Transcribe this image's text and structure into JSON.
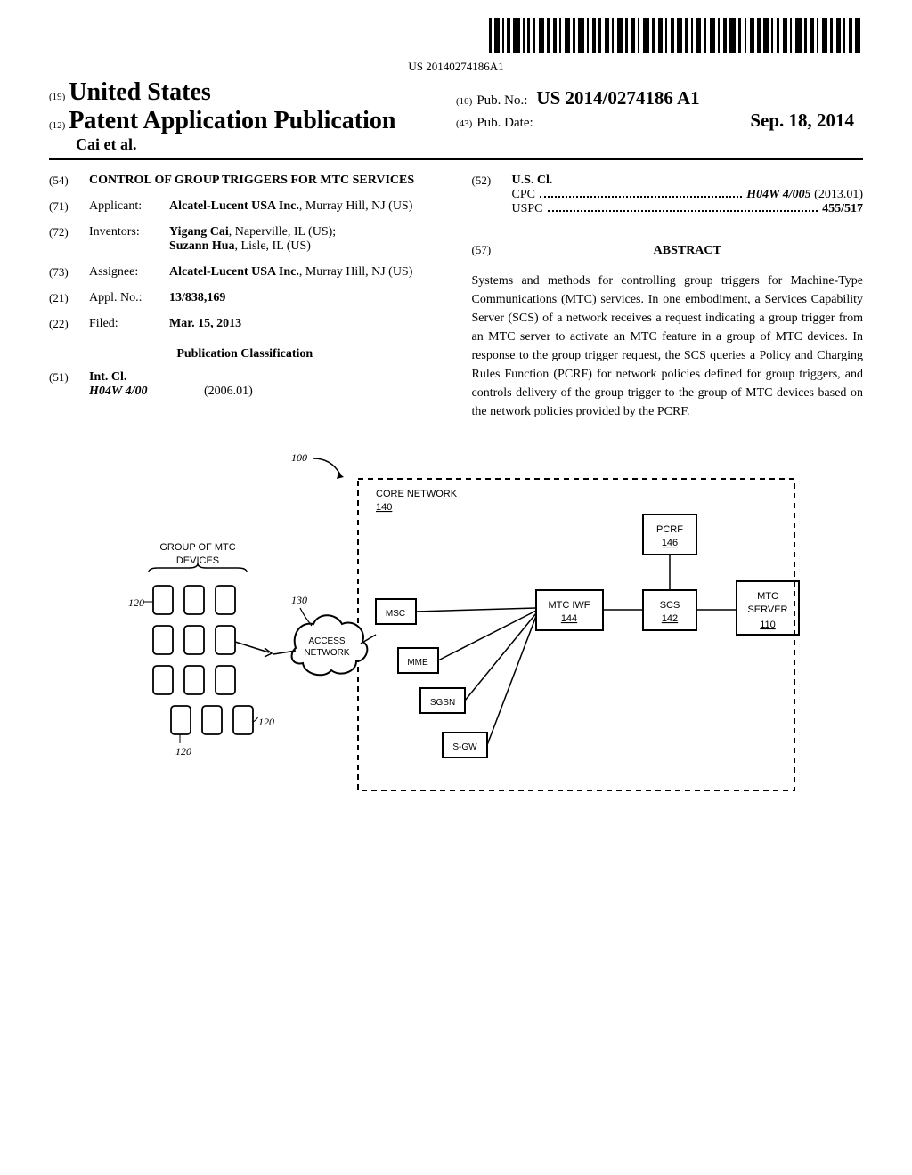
{
  "barcode_number": "US 20140274186A1",
  "header": {
    "inid_country": "(19)",
    "country": "United States",
    "inid_pubtype": "(12)",
    "pub_type": "Patent Application Publication",
    "authors": "Cai et al.",
    "inid_pubno": "(10)",
    "pubno_label": "Pub. No.:",
    "pubno_value": "US 2014/0274186 A1",
    "inid_pubdate": "(43)",
    "pubdate_label": "Pub. Date:",
    "pubdate_value": "Sep. 18, 2014"
  },
  "fields": {
    "title": {
      "code": "(54)",
      "value": "CONTROL OF GROUP TRIGGERS FOR MTC SERVICES"
    },
    "applicant": {
      "code": "(71)",
      "label": "Applicant:",
      "name": "Alcatel-Lucent USA Inc.",
      "location": ", Murray Hill, NJ (US)"
    },
    "inventors": {
      "code": "(72)",
      "label": "Inventors:",
      "name1": "Yigang Cai",
      "loc1": ", Naperville, IL (US);",
      "name2": "Suzann Hua",
      "loc2": ", Lisle, IL (US)"
    },
    "assignee": {
      "code": "(73)",
      "label": "Assignee:",
      "name": "Alcatel-Lucent USA Inc.",
      "location": ", Murray Hill, NJ (US)"
    },
    "applno": {
      "code": "(21)",
      "label": "Appl. No.:",
      "value": "13/838,169"
    },
    "filed": {
      "code": "(22)",
      "label": "Filed:",
      "value": "Mar. 15, 2013"
    },
    "pubclass_header": "Publication Classification",
    "intcl": {
      "code": "(51)",
      "label": "Int. Cl.",
      "class": "H04W 4/00",
      "date": "(2006.01)"
    },
    "uscl": {
      "code": "(52)",
      "label": "U.S. Cl.",
      "cpc_label": "CPC",
      "cpc_value": "H04W 4/005",
      "cpc_date": " (2013.01)",
      "uspc_label": "USPC",
      "uspc_value": "455/517"
    }
  },
  "abstract": {
    "code": "(57)",
    "header": "ABSTRACT",
    "text": "Systems and methods for controlling group triggers for Machine-Type Communications (MTC) services. In one embodiment, a Services Capability Server (SCS) of a network receives a request indicating a group trigger from an MTC server to activate an MTC feature in a group of MTC devices. In response to the group trigger request, the SCS queries a Policy and Charging Rules Function (PCRF) for network policies defined for group triggers, and controls delivery of the group trigger to the group of MTC devices based on the network policies provided by the PCRF."
  },
  "figure": {
    "ref_100": "100",
    "core_network": "CORE NETWORK",
    "core_network_num": "140",
    "pcrf": "PCRF",
    "pcrf_num": "146",
    "group_mtc": "GROUP OF MTC\nDEVICES",
    "mtc_iwf": "MTC IWF",
    "mtc_iwf_num": "144",
    "scs": "SCS",
    "scs_num": "142",
    "mtc_server": "MTC\nSERVER",
    "mtc_server_num": "110",
    "msc": "MSC",
    "mme": "MME",
    "sgsn": "SGSN",
    "sgw": "S-GW",
    "access_network": "ACCESS\nNETWORK",
    "ref_120_1": "120",
    "ref_120_2": "120",
    "ref_120_3": "120",
    "ref_120_4": "120",
    "ref_130": "130"
  }
}
